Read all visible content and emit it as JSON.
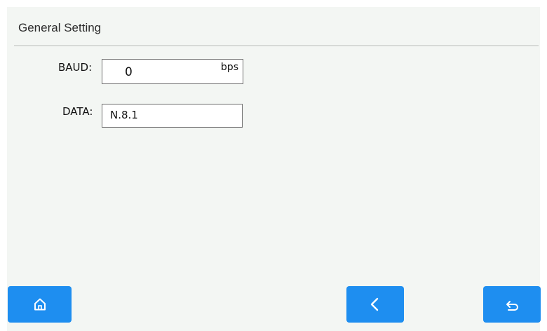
{
  "header": {
    "title": "General Setting"
  },
  "fields": {
    "baud": {
      "label": "BAUD:",
      "value": "0",
      "unit": "bps"
    },
    "data": {
      "label": "DATA:",
      "value": "N.8.1"
    }
  },
  "nav": {
    "home_icon": "home-icon",
    "prev_icon": "chevron-left-icon",
    "back_icon": "return-icon"
  },
  "colors": {
    "background": "#f3f6f3",
    "button": "#1e8ef0",
    "divider": "#d6d9d6"
  }
}
